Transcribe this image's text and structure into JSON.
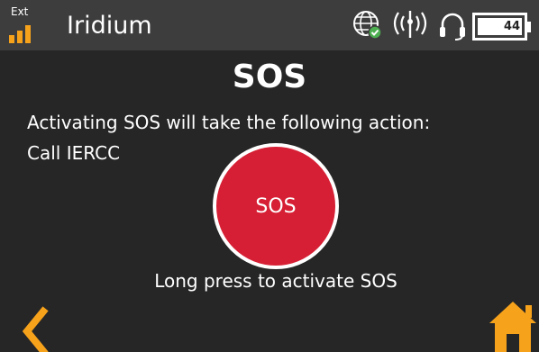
{
  "status_bar": {
    "signal_source": "Ext",
    "network_name": "Iridium",
    "battery_level": "44",
    "icons": [
      "signal-bars-icon",
      "globe-gps-icon",
      "antenna-icon",
      "headset-icon",
      "battery-icon"
    ]
  },
  "page": {
    "title": "SOS",
    "description": "Activating SOS will take the following action:",
    "action": "Call IERCC",
    "sos_button_label": "SOS",
    "hint": "Long press to activate SOS"
  },
  "navigation": {
    "back_icon": "chevron-left-icon",
    "home_icon": "home-icon"
  },
  "colors": {
    "background": "#262626",
    "status_bar": "#3d3d3d",
    "accent": "#f7a21b",
    "sos_red": "#d61f34",
    "gps_ok": "#4caf50",
    "text": "#ffffff"
  }
}
